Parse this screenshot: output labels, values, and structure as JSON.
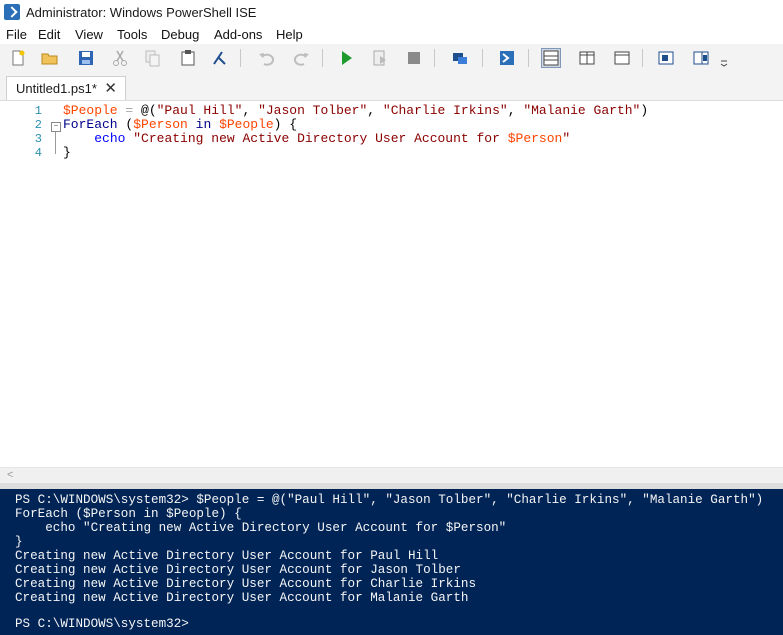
{
  "window": {
    "title": "Administrator: Windows PowerShell ISE"
  },
  "menu": [
    "File",
    "Edit",
    "View",
    "Tools",
    "Debug",
    "Add-ons",
    "Help"
  ],
  "toolbar": {
    "icons": [
      "new-file-icon",
      "open-icon",
      "save-icon",
      "cut-icon",
      "copy-icon",
      "paste-icon",
      "clear-console-icon",
      "undo-icon",
      "redo-icon",
      "run-icon",
      "run-selection-icon",
      "stop-icon",
      "remote-powershell-icon",
      "powershell-launch-icon",
      "layout-script-top-icon",
      "layout-script-right-icon",
      "layout-script-max-icon",
      "show-script-pane-icon",
      "show-commands-icon",
      "toolbar-overflow-icon"
    ]
  },
  "tab": {
    "label": "Untitled1.ps1*",
    "close": "✕"
  },
  "editor": {
    "line_numbers": [
      "1",
      "2",
      "3",
      "4"
    ],
    "lines": [
      [
        {
          "t": "$People",
          "c": "var"
        },
        {
          "t": " = ",
          "c": "op"
        },
        {
          "t": "@(",
          "c": ""
        },
        {
          "t": "\"Paul Hill\"",
          "c": "str"
        },
        {
          "t": ", ",
          "c": ""
        },
        {
          "t": "\"Jason Tolber\"",
          "c": "str"
        },
        {
          "t": ", ",
          "c": ""
        },
        {
          "t": "\"Charlie Irkins\"",
          "c": "str"
        },
        {
          "t": ", ",
          "c": ""
        },
        {
          "t": "\"Malanie Garth\"",
          "c": "str"
        },
        {
          "t": ")",
          "c": ""
        }
      ],
      [
        {
          "t": "ForEach",
          "c": "kw"
        },
        {
          "t": " (",
          "c": ""
        },
        {
          "t": "$Person",
          "c": "var"
        },
        {
          "t": " ",
          "c": ""
        },
        {
          "t": "in",
          "c": "kw"
        },
        {
          "t": " ",
          "c": ""
        },
        {
          "t": "$People",
          "c": "var"
        },
        {
          "t": ") {",
          "c": ""
        }
      ],
      [
        {
          "t": "    ",
          "c": ""
        },
        {
          "t": "echo",
          "c": "cmd"
        },
        {
          "t": " ",
          "c": ""
        },
        {
          "t": "\"Creating new Active Directory User Account for ",
          "c": "str"
        },
        {
          "t": "$Person",
          "c": "var"
        },
        {
          "t": "\"",
          "c": "str"
        }
      ],
      [
        {
          "t": "}",
          "c": ""
        }
      ]
    ]
  },
  "scroll": {
    "left_arrow": "<"
  },
  "console": {
    "lines": [
      "PS C:\\WINDOWS\\system32> $People = @(\"Paul Hill\", \"Jason Tolber\", \"Charlie Irkins\", \"Malanie Garth\")",
      "ForEach ($Person in $People) {",
      "    echo \"Creating new Active Directory User Account for $Person\"",
      "}",
      "Creating new Active Directory User Account for Paul Hill",
      "Creating new Active Directory User Account for Jason Tolber",
      "Creating new Active Directory User Account for Charlie Irkins",
      "Creating new Active Directory User Account for Malanie Garth",
      "",
      "PS C:\\WINDOWS\\system32>"
    ]
  },
  "colors": {
    "console_bg": "#012456",
    "variable": "#ff4500",
    "keyword": "#00008b",
    "string": "#8b0000",
    "command": "#0000ff",
    "line_number": "#2b91af"
  }
}
